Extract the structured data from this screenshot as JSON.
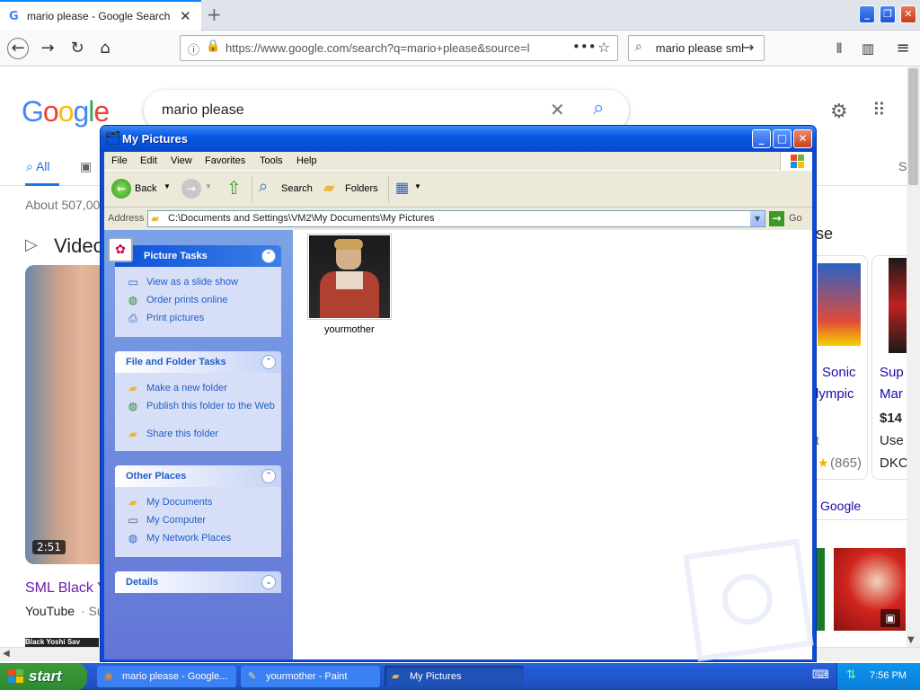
{
  "firefox": {
    "tab_title": "mario please - Google Search",
    "url": "https://www.google.com/search?q=mario+please&source=l",
    "search_value": "mario please sml"
  },
  "google": {
    "logo": "Google",
    "query": "mario please",
    "tab_all": "All",
    "tab_s": "S",
    "result_stats": "About 507,00",
    "videos_heading": "Video",
    "video_duration": "2:51",
    "video_title": "SML Black Y",
    "video_source": "YouTube",
    "video_source_tail": "· Su",
    "caption_black": "Black Yoshi Sav",
    "shopping_heading_tail": "se",
    "product1": {
      "name_line1": "Sonic",
      "name_line2": "lympic",
      "rating": "(865)",
      "tail": "t"
    },
    "product2": {
      "name_line1": "Sup",
      "name_line2": "Mar",
      "price": "$14",
      "condition": "Use",
      "seller": "DKC"
    },
    "more_google": "Google"
  },
  "explorer": {
    "title": "My Pictures",
    "menu": [
      "File",
      "Edit",
      "View",
      "Favorites",
      "Tools",
      "Help"
    ],
    "toolbar": {
      "back": "Back",
      "search": "Search",
      "folders": "Folders"
    },
    "address_label": "Address",
    "address_value": "C:\\Documents and Settings\\VM2\\My Documents\\My Pictures",
    "go_label": "Go",
    "picture_tasks": {
      "title": "Picture Tasks",
      "items": [
        "View as a slide show",
        "Order prints online",
        "Print pictures"
      ]
    },
    "file_tasks": {
      "title": "File and Folder Tasks",
      "items": [
        "Make a new folder",
        "Publish this folder to the Web",
        "Share this folder"
      ]
    },
    "other_places": {
      "title": "Other Places",
      "items": [
        "My Documents",
        "My Computer",
        "My Network Places"
      ]
    },
    "details": {
      "title": "Details"
    },
    "files": [
      {
        "name": "yourmother"
      }
    ]
  },
  "taskbar": {
    "start_label": "start",
    "buttons": [
      "mario please - Google...",
      "yourmother - Paint",
      "My Pictures"
    ],
    "clock": "7:56 PM"
  }
}
